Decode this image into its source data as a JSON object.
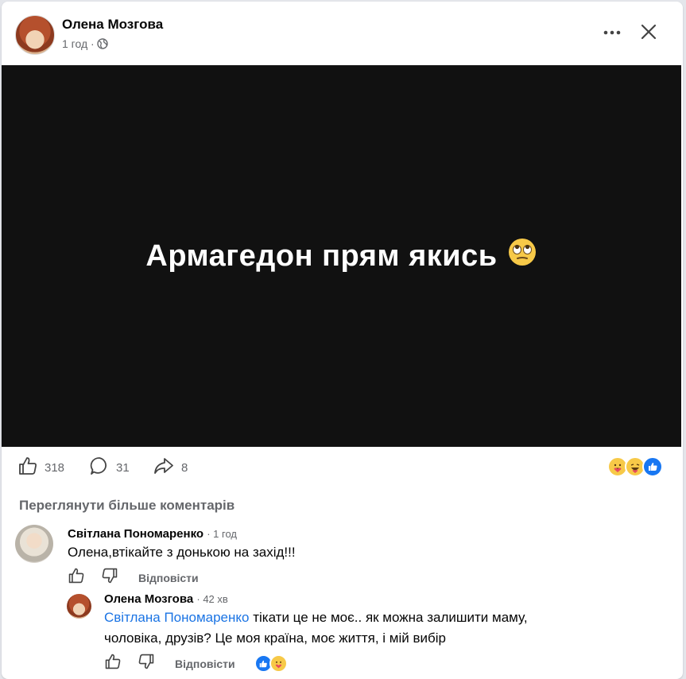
{
  "post": {
    "author": "Олена Мозгова",
    "time": "1 год ·",
    "text": "Армагедон прям якись",
    "likes": "318",
    "comments": "31",
    "shares": "8",
    "reaction_icons": [
      "care-icon",
      "haha-icon",
      "like-icon"
    ]
  },
  "see_more": "Переглянути більше коментарів",
  "comments": [
    {
      "author": "Світлана Пономаренко",
      "time": "· 1 год",
      "text": "Олена,втікайте з донькою на захід!!!",
      "reply_label": "Відповісти"
    },
    {
      "author": "Олена Мозгова",
      "time": "· 42 хв",
      "mention": "Світлана Пономаренко",
      "text_line1": " тікати це не моє.. як можна залишити маму,",
      "text_line2": "чоловіка, друзів? Це моя країна, моє життя, і мій вибір",
      "reply_label": "Відповісти",
      "reaction_icons": [
        "like-icon",
        "care-icon"
      ]
    }
  ],
  "colors": {
    "accent": "#1b74e4",
    "media_bg": "#111111",
    "secondary_text": "#65676b"
  }
}
